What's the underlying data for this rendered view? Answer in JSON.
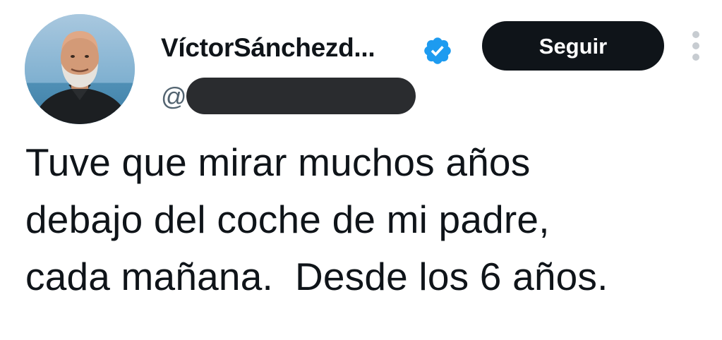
{
  "tweet": {
    "author": {
      "display_name": "VíctorSánchezd...",
      "verified": true,
      "handle_prefix": "@",
      "avatar_icon": "profile-photo-man-beard",
      "verified_icon": "verified-badge-icon"
    },
    "actions": {
      "follow_label": "Seguir",
      "more_icon": "more-vertical-icon"
    },
    "text_lines": [
      "Tuve que mirar muchos años",
      "debajo del coche de mi padre,",
      "cada mañana.  Desde los 6 años."
    ]
  },
  "colors": {
    "text": "#0f1419",
    "secondary_text": "#536471",
    "button_bg": "#0f1419",
    "button_text": "#ffffff",
    "verified_blue": "#1d9bf0",
    "redaction": "#2a2c2f",
    "more_dots": "#c7ccd1"
  }
}
